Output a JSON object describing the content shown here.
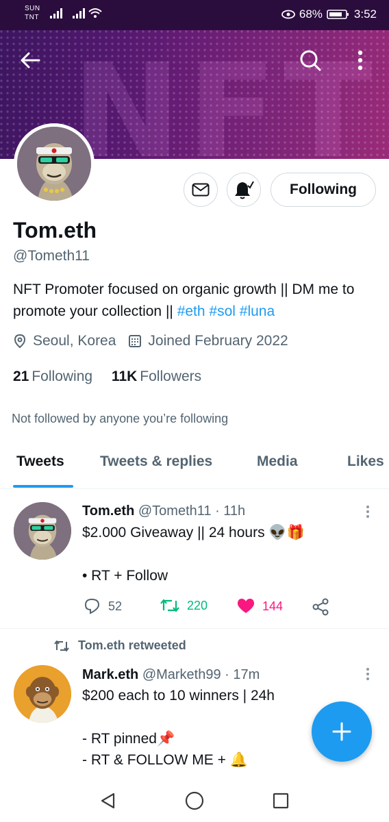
{
  "status_bar": {
    "carrier_day": "SUN",
    "carrier_name": "TNT",
    "battery": "68%",
    "time": "3:52"
  },
  "banner": {
    "text": "NFT"
  },
  "profile": {
    "name": "Tom.eth",
    "handle": "@Tometh11",
    "bio_text": "NFT Promoter focused on organic growth || DM me to promote your collection || ",
    "bio_hashtags": [
      "#eth",
      "#sol",
      "#luna"
    ],
    "location": "Seoul, Korea",
    "joined": "Joined February 2022",
    "following_count": "21",
    "following_label": "Following",
    "followers_count": "11K",
    "followers_label": "Followers",
    "not_followed_text": "Not followed by anyone you’re following",
    "follow_button_label": "Following"
  },
  "tabs": [
    {
      "label": "Tweets",
      "active": true
    },
    {
      "label": "Tweets & replies",
      "active": false
    },
    {
      "label": "Media",
      "active": false
    },
    {
      "label": "Likes",
      "active": false
    }
  ],
  "tweets": [
    {
      "name": "Tom.eth",
      "handle": "@Tometh11",
      "time": "· 11h",
      "line1": "$2.000 Giveaway || 24 hours 👽🎁",
      "line2": "• RT + Follow",
      "replies": "52",
      "retweets": "220",
      "likes": "144"
    },
    {
      "retweeted_by": "Tom.eth retweeted",
      "name": "Mark.eth",
      "handle": "@Marketh99",
      "time": "· 17m",
      "line1": "$200 each to 10 winners | 24h",
      "line2": "- RT pinned📌",
      "line3": "- RT & FOLLOW ME + 🔔"
    }
  ],
  "colors": {
    "accent": "#1d9bf0",
    "retweet_green": "#00ba7c",
    "like_pink": "#f91880",
    "secondary_text": "#536471"
  },
  "icons": [
    "back-arrow-icon",
    "search-icon",
    "more-vertical-icon",
    "mail-icon",
    "bell-icon",
    "location-pin-icon",
    "calendar-icon",
    "reply-icon",
    "retweet-icon",
    "heart-icon",
    "share-icon",
    "plus-icon"
  ]
}
